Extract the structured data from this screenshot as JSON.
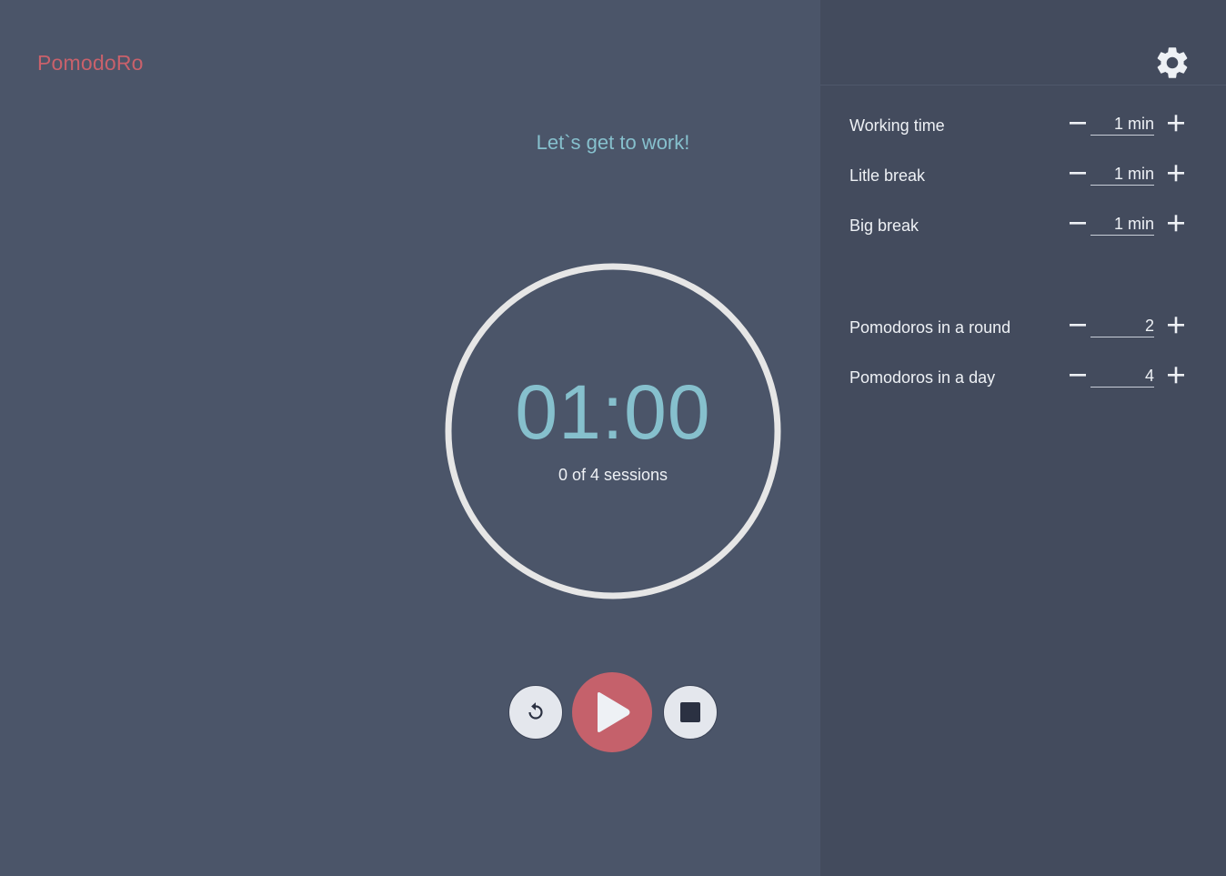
{
  "app": {
    "brand": "PomodoRo",
    "accent_color": "#c9616b",
    "timer_color": "#86c0cd"
  },
  "main": {
    "motivation": "Let`s get to work!",
    "timer": {
      "time": "01:00",
      "sessions": "0 of 4 sessions"
    },
    "controls": {
      "reset_icon": "reset-icon",
      "play_icon": "play-icon",
      "stop_icon": "stop-icon"
    }
  },
  "sidebar": {
    "settings_icon": "gear-icon",
    "settings": [
      {
        "label": "Working time",
        "value": "1 min"
      },
      {
        "label": "Litle break",
        "value": "1 min"
      },
      {
        "label": "Big break",
        "value": "1 min"
      },
      {
        "label": "Pomodoros in a round",
        "value": "2"
      },
      {
        "label": "Pomodoros in a day",
        "value": "4"
      }
    ]
  }
}
